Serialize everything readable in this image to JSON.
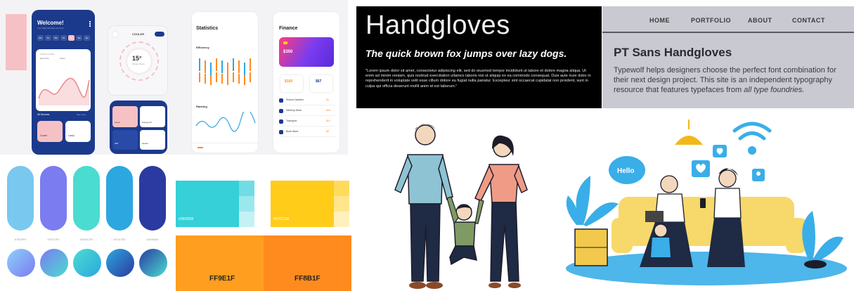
{
  "mobile": {
    "phone1": {
      "title": "Welcome!",
      "subtitle": "Your daily activities are here",
      "days": [
        "Mo",
        "Tu",
        "We",
        "Th",
        "Fr",
        "Sa",
        "Su"
      ],
      "card_label": "SMART HOME",
      "card_value": "$3.1.1",
      "legend_a": "Electricity",
      "legend_b": "Water",
      "devices_label": "All Devices",
      "devices_link": "See more",
      "device_a": "Cooler",
      "device_b": "Lamp"
    },
    "phone2": {
      "title": "COOLER",
      "temp": "15°",
      "temp_sub": "Perfect Temp",
      "tiles": [
        "Lamp",
        "Energy AC",
        "Wifi",
        "Heater"
      ]
    },
    "phone3": {
      "title": "Statistics",
      "efficiency": "Efficiency",
      "ranking": "Ranking"
    },
    "phone4": {
      "title": "Finance",
      "balance": "$350",
      "stat_a": "$100",
      "stat_b": "$67",
      "rows": [
        "School Canteen",
        "Delivery Store",
        "Transport",
        "Book Store"
      ],
      "amounts": [
        "-$4",
        "-$16",
        "-$24",
        "-$8"
      ]
    }
  },
  "palette": {
    "pills": [
      {
        "color": "#78C8F0",
        "label": "#78C8F0"
      },
      {
        "color": "#7A7CF0",
        "label": "#7A7CF0"
      },
      {
        "color": "#4ADCD0",
        "label": "#4ADCD0"
      },
      {
        "color": "#2CA7E0",
        "label": "#2CA7E0"
      },
      {
        "color": "#2A3AA0",
        "label": "#2A3AA0"
      }
    ],
    "gradients": [
      {
        "from": "#8ED0FA",
        "to": "#7A7CF0"
      },
      {
        "from": "#7A7CF0",
        "to": "#4ADCD0"
      },
      {
        "from": "#4ADCD0",
        "to": "#2CA7E0"
      },
      {
        "from": "#2CA7E0",
        "to": "#2A3AA0"
      },
      {
        "from": "#2A3AA0",
        "to": "#4ADCD0"
      }
    ],
    "swatch_teal": {
      "color": "#35D0D8",
      "label": "#35D0D8",
      "shades": [
        "#6FDDE3",
        "#9BE8EC",
        "#C4F2F4"
      ]
    },
    "swatch_yellow": {
      "color": "#FFCC1A",
      "label": "#FFCC1A",
      "shades": [
        "#FFDB5C",
        "#FFE68C",
        "#FFF1BE"
      ]
    },
    "swatch_orange_a": {
      "color": "#FF9E1F",
      "label": "FF9E1F"
    },
    "swatch_orange_b": {
      "color": "#FF8B1F",
      "label": "FF8B1F"
    }
  },
  "handgloves": {
    "title": "Handgloves",
    "subtitle": "The quick brown fox jumps over lazy dogs.",
    "body": "\"Lorem ipsum dolor sit amet, consectetur adipiscing elit, sed do eiusmod tempor incididunt ut labore et dolore magna aliqua. Ut enim ad minim veniam, quis nostrud exercitation ullamco laboris nisi ut aliquip ex ea commodo consequat. Duis aute irure dolor in reprehenderit in voluptate velit esse cillum dolore eu fugiat nulla pariatur. Excepteur sint occaecat cupidatat non proident, sunt in culpa qui officia deserunt mollit anim id est laborum.\""
  },
  "ptsans": {
    "nav": [
      "HOME",
      "PORTFOLIO",
      "ABOUT",
      "CONTACT"
    ],
    "title": "PT Sans Handgloves",
    "body_plain": "Typewolf helps designers choose the perfect font combination for their next design project. This site is an independent typography resource that features typefaces from ",
    "body_italic": "all type foundries."
  },
  "social": {
    "bubble": "Hello"
  },
  "colors": {
    "navy": "#1B3A8C",
    "pink": "#F6C1C4",
    "orange": "#FF8B1F",
    "social_blue": "#3AAEE8",
    "sofa_yellow": "#F7D86A"
  }
}
